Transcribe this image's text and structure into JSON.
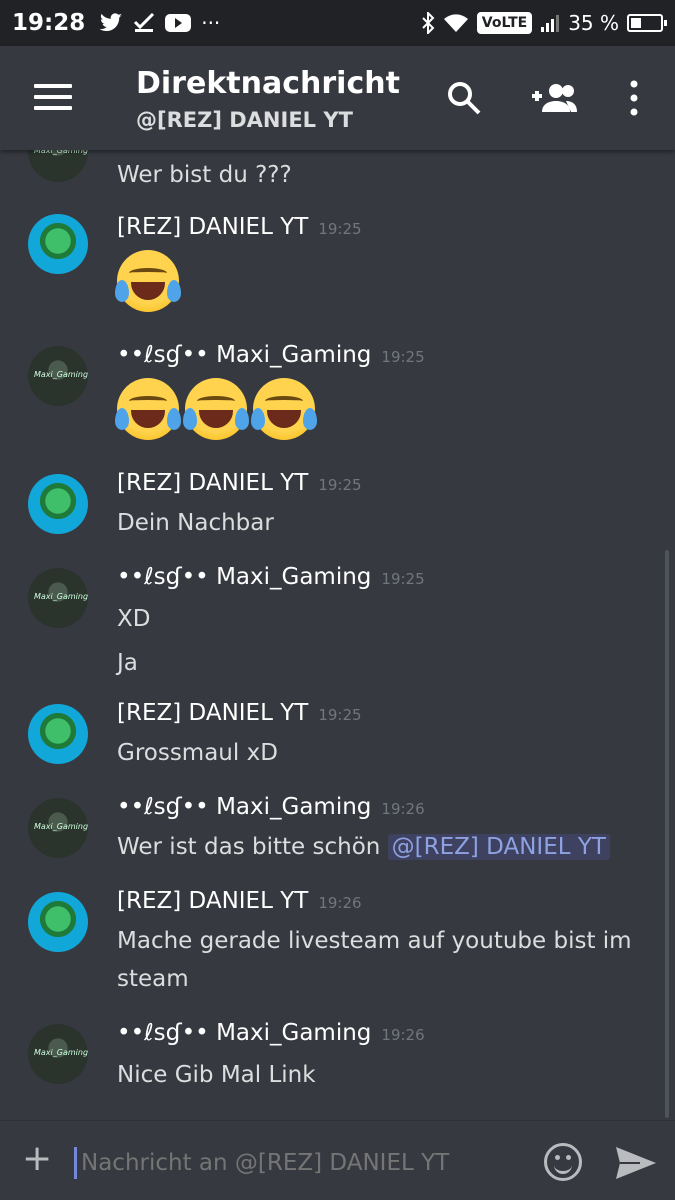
{
  "status_bar": {
    "time": "19:28",
    "notif_icons": [
      "twitter-icon",
      "checkmark-icon",
      "youtube-icon",
      "more-icon"
    ],
    "volte": "VoLTE",
    "battery_text": "35 %",
    "battery_level": 0.35
  },
  "header": {
    "title": "Direktnachricht",
    "subtitle": "@[REZ] DANIEL YT"
  },
  "messages": [
    {
      "lines": [
        "Wer bist du ???"
      ]
    },
    {
      "author": "[REZ] DANIEL YT",
      "time": "19:25",
      "emoji_count": 1
    },
    {
      "author": "••ℓѕɠ•• Maxi_Gaming",
      "time": "19:25",
      "emoji_count": 3
    },
    {
      "author": "[REZ] DANIEL YT",
      "time": "19:25",
      "lines": [
        "Dein Nachbar"
      ]
    },
    {
      "author": "••ℓѕɠ•• Maxi_Gaming",
      "time": "19:25",
      "lines": [
        "XD",
        "Ja"
      ]
    },
    {
      "author": "[REZ] DANIEL YT",
      "time": "19:25",
      "lines": [
        "Grossmaul xD"
      ]
    },
    {
      "author": "••ℓѕɠ•• Maxi_Gaming",
      "time": "19:26",
      "text": "Wer ist das bitte schön",
      "mention": "@[REZ] DANIEL YT"
    },
    {
      "author": "[REZ] DANIEL YT",
      "time": "19:26",
      "lines": [
        "Mache gerade livesteam auf youtube bist im",
        "steam"
      ]
    },
    {
      "author": "••ℓѕɠ•• Maxi_Gaming",
      "time": "19:26",
      "lines": [
        "Nice Gib Mal Link"
      ]
    }
  ],
  "avatar_label": "Maxi_Gaming",
  "composer": {
    "placeholder": "Nachricht an @[REZ] DANIEL YT"
  }
}
